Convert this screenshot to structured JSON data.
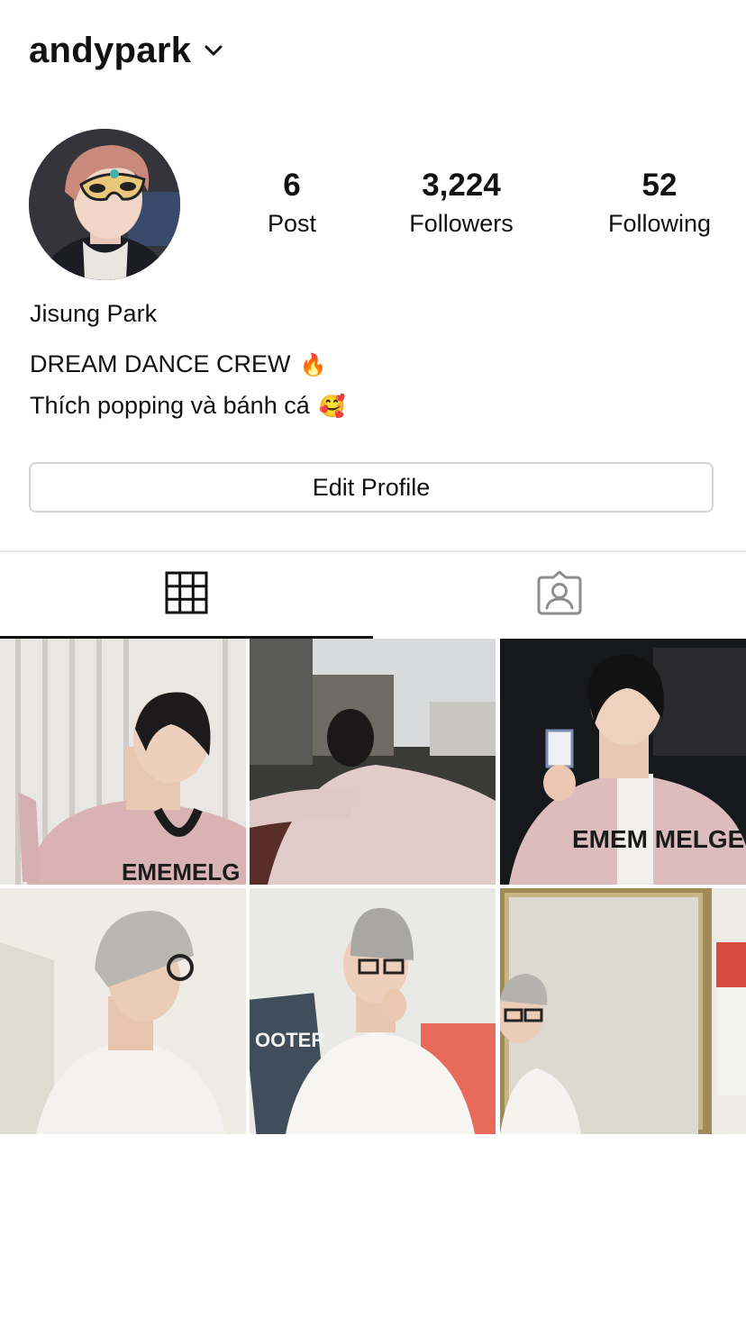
{
  "header": {
    "username": "andypark",
    "dropdown_icon": "chevron-down-icon"
  },
  "profile": {
    "full_name": "Jisung Park",
    "bio_lines": [
      {
        "text": "DREAM DANCE CREW",
        "emoji": "🔥"
      },
      {
        "text": "Thích popping và bánh cá",
        "emoji": "🥰"
      }
    ]
  },
  "stats": [
    {
      "value": "6",
      "label": "Post"
    },
    {
      "value": "3,224",
      "label": "Followers"
    },
    {
      "value": "52",
      "label": "Following"
    }
  ],
  "edit_profile_label": "Edit Profile",
  "tabs": [
    {
      "icon": "grid-icon",
      "active": true
    },
    {
      "icon": "tagged-person-icon",
      "active": false
    }
  ],
  "posts": [
    {
      "description_icon": "photo"
    },
    {
      "description_icon": "photo"
    },
    {
      "description_icon": "photo"
    },
    {
      "description_icon": "photo"
    },
    {
      "description_icon": "photo"
    },
    {
      "description_icon": "photo"
    }
  ],
  "colors": {
    "text": "#111111",
    "border": "#d4d4d4",
    "divider": "#e8e8e8",
    "background": "#ffffff"
  }
}
